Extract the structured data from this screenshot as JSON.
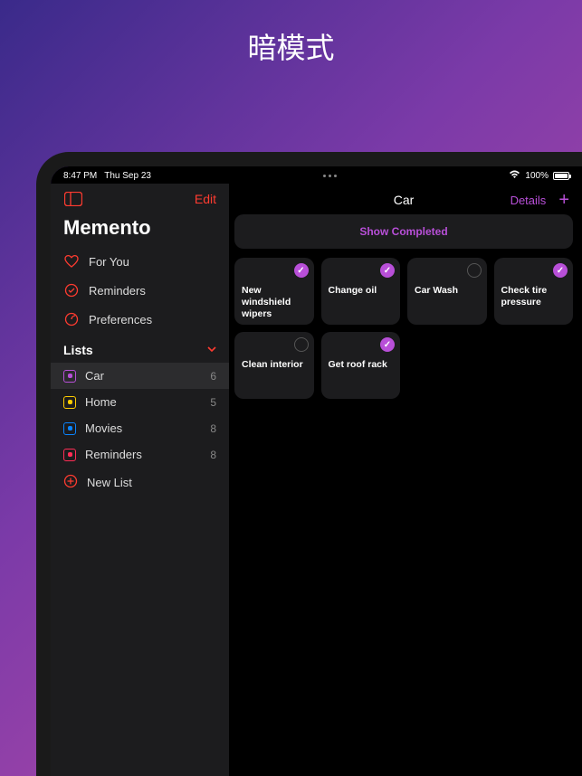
{
  "page_heading": "暗模式",
  "status": {
    "time": "8:47 PM",
    "date": "Thu Sep 23",
    "battery": "100%"
  },
  "sidebar": {
    "edit": "Edit",
    "app_name": "Memento",
    "nav": [
      {
        "icon": "heart",
        "label": "For You"
      },
      {
        "icon": "clock-check",
        "label": "Reminders"
      },
      {
        "icon": "gear",
        "label": "Preferences"
      }
    ],
    "lists_header": "Lists",
    "lists": [
      {
        "name": "Car",
        "count": 6,
        "color": "#b84fd8",
        "selected": true
      },
      {
        "name": "Home",
        "count": 5,
        "color": "#ffcc00",
        "selected": false
      },
      {
        "name": "Movies",
        "count": 8,
        "color": "#0a84ff",
        "selected": false
      },
      {
        "name": "Reminders",
        "count": 8,
        "color": "#ff2d55",
        "selected": false
      }
    ],
    "new_list": "New List"
  },
  "main": {
    "title": "Car",
    "details": "Details",
    "show_completed": "Show Completed",
    "tasks": [
      {
        "label": "New windshield wipers",
        "done": true
      },
      {
        "label": "Change oil",
        "done": true
      },
      {
        "label": "Car Wash",
        "done": false
      },
      {
        "label": "Check tire pressure",
        "done": true
      },
      {
        "label": "Clean interior",
        "done": false
      },
      {
        "label": "Get roof rack",
        "done": true
      }
    ]
  },
  "colors": {
    "accent": "#b84fd8",
    "danger": "#ff3b30"
  }
}
